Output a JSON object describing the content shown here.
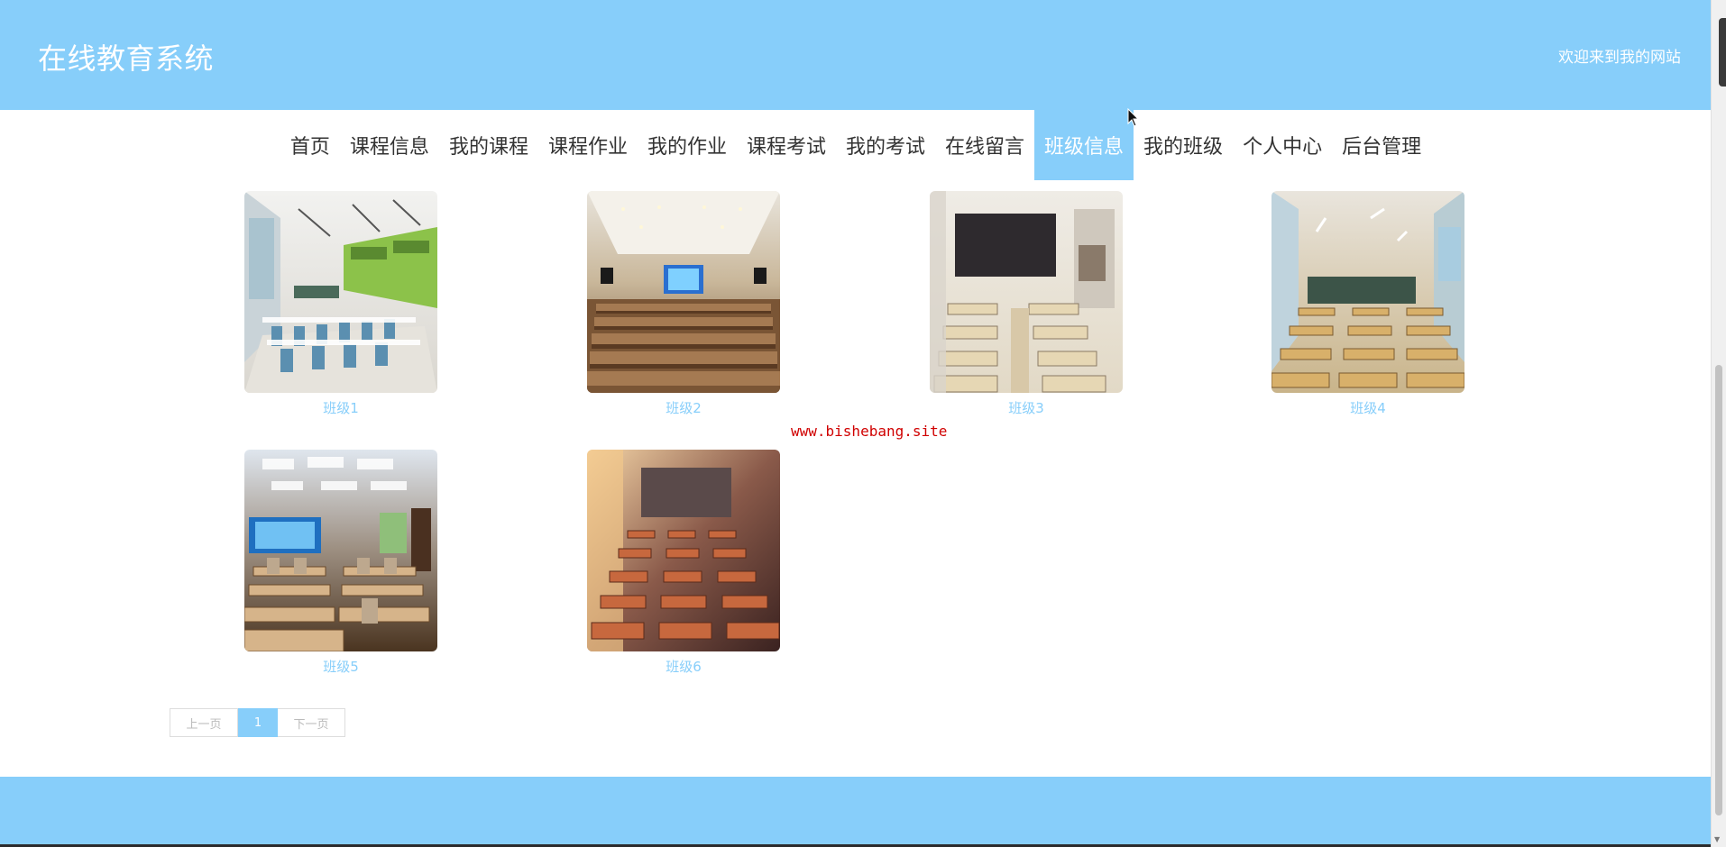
{
  "header": {
    "site_title": "在线教育系统",
    "welcome": "欢迎来到我的网站"
  },
  "nav": {
    "items": [
      {
        "label": "首页"
      },
      {
        "label": "课程信息"
      },
      {
        "label": "我的课程"
      },
      {
        "label": "课程作业"
      },
      {
        "label": "我的作业"
      },
      {
        "label": "课程考试"
      },
      {
        "label": "我的考试"
      },
      {
        "label": "在线留言"
      },
      {
        "label": "班级信息"
      },
      {
        "label": "我的班级"
      },
      {
        "label": "个人中心"
      },
      {
        "label": "后台管理"
      }
    ],
    "active": "班级信息"
  },
  "classes": [
    {
      "label": "班级1"
    },
    {
      "label": "班级2"
    },
    {
      "label": "班级3"
    },
    {
      "label": "班级4"
    },
    {
      "label": "班级5"
    },
    {
      "label": "班级6"
    }
  ],
  "watermark": "www.bishebang.site",
  "pagination": {
    "prev": "上一页",
    "current": "1",
    "next": "下一页"
  },
  "colors": {
    "accent": "#87cefa",
    "watermark": "#d00000"
  },
  "icons": {
    "cursor": "mouse-pointer-icon"
  }
}
